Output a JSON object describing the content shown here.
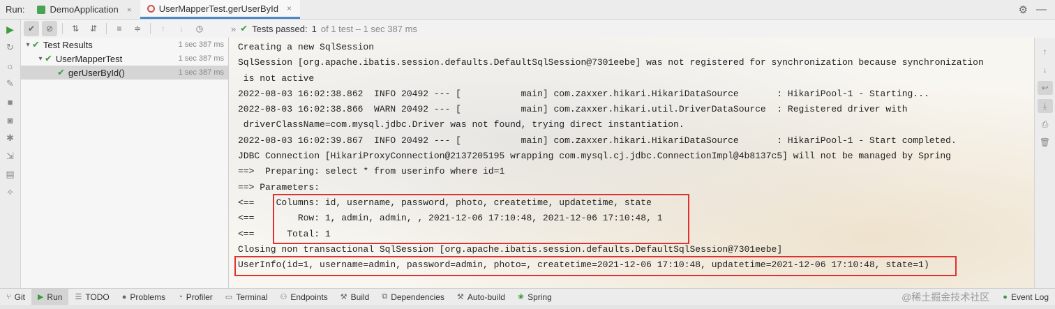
{
  "runbar": {
    "label": "Run:",
    "tabs": [
      {
        "label": "DemoApplication",
        "active": false
      },
      {
        "label": "UserMapperTest.gerUserById",
        "active": true
      }
    ],
    "close_glyph": "×"
  },
  "test_toolbar": {
    "status_text": "Tests passed:",
    "passed_count": "1",
    "detail": "of 1 test – 1 sec 387 ms"
  },
  "tree": {
    "rows": [
      {
        "label": "Test Results",
        "time": "1 sec 387 ms",
        "indent": 0
      },
      {
        "label": "UserMapperTest",
        "time": "1 sec 387 ms",
        "indent": 1
      },
      {
        "label": "gerUserById()",
        "time": "1 sec 387 ms",
        "indent": 2
      }
    ]
  },
  "console": {
    "lines": [
      "Creating a new SqlSession",
      "SqlSession [org.apache.ibatis.session.defaults.DefaultSqlSession@7301eebe] was not registered for synchronization because synchronization",
      " is not active",
      "2022-08-03 16:02:38.862  INFO 20492 --- [           main] com.zaxxer.hikari.HikariDataSource       : HikariPool-1 - Starting...",
      "2022-08-03 16:02:38.866  WARN 20492 --- [           main] com.zaxxer.hikari.util.DriverDataSource  : Registered driver with",
      " driverClassName=com.mysql.jdbc.Driver was not found, trying direct instantiation.",
      "2022-08-03 16:02:39.867  INFO 20492 --- [           main] com.zaxxer.hikari.HikariDataSource       : HikariPool-1 - Start completed.",
      "JDBC Connection [HikariProxyConnection@2137205195 wrapping com.mysql.cj.jdbc.ConnectionImpl@4b8137c5] will not be managed by Spring",
      "==>  Preparing: select * from userinfo where id=1",
      "==> Parameters: ",
      "<==    Columns: id, username, password, photo, createtime, updatetime, state",
      "<==        Row: 1, admin, admin, , 2021-12-06 17:10:48, 2021-12-06 17:10:48, 1",
      "<==      Total: 1",
      "Closing non transactional SqlSession [org.apache.ibatis.session.defaults.DefaultSqlSession@7301eebe]",
      "UserInfo(id=1, username=admin, password=admin, photo=, createtime=2021-12-06 17:10:48, updatetime=2021-12-06 17:10:48, state=1)"
    ]
  },
  "bottombar": {
    "items": [
      {
        "label": "Git",
        "icon": "git-icon",
        "active": false
      },
      {
        "label": "Run",
        "icon": "run-icon",
        "active": true
      },
      {
        "label": "TODO",
        "icon": "list-icon",
        "active": false
      },
      {
        "label": "Problems",
        "icon": "problems-icon",
        "active": false
      },
      {
        "label": "Profiler",
        "icon": "profiler-icon",
        "active": false
      },
      {
        "label": "Terminal",
        "icon": "terminal-icon",
        "active": false
      },
      {
        "label": "Endpoints",
        "icon": "endpoints-icon",
        "active": false
      },
      {
        "label": "Build",
        "icon": "hammer-icon",
        "active": false
      },
      {
        "label": "Dependencies",
        "icon": "dependencies-icon",
        "active": false
      },
      {
        "label": "Auto-build",
        "icon": "auto-build-icon",
        "active": false
      },
      {
        "label": "Spring",
        "icon": "spring-icon",
        "active": false
      }
    ],
    "watermark": "@稀土掘金技术社区",
    "event_log": "Event Log"
  },
  "colors": {
    "accent": "#4a88c7",
    "pass_green": "#3c9b3c",
    "highlight_red": "#e03131"
  }
}
